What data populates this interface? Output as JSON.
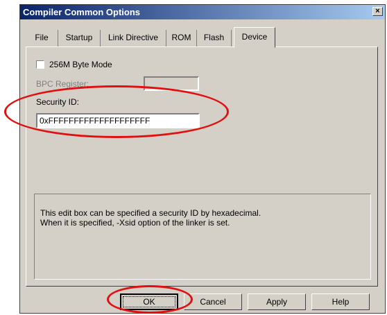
{
  "dialog": {
    "title": "Compiler Common Options",
    "close_label": "×"
  },
  "tabs": [
    {
      "label": "File"
    },
    {
      "label": "Startup"
    },
    {
      "label": "Link Directive"
    },
    {
      "label": "ROM"
    },
    {
      "label": "Flash"
    },
    {
      "label": "Device",
      "active": true
    }
  ],
  "device": {
    "byte_mode_label": "256M Byte Mode",
    "byte_mode_checked": false,
    "bpc_register_label": "BPC Register:",
    "bpc_register_value": "",
    "security_id_label": "Security ID:",
    "security_id_value": "0xFFFFFFFFFFFFFFFFFFFF",
    "description_line1": "This edit box can be specified a security ID by hexadecimal.",
    "description_line2": "When it is specified, -Xsid option of the linker is set."
  },
  "buttons": {
    "ok": "OK",
    "cancel": "Cancel",
    "apply": "Apply",
    "help": "Help"
  },
  "annotation_color": "#e01010"
}
